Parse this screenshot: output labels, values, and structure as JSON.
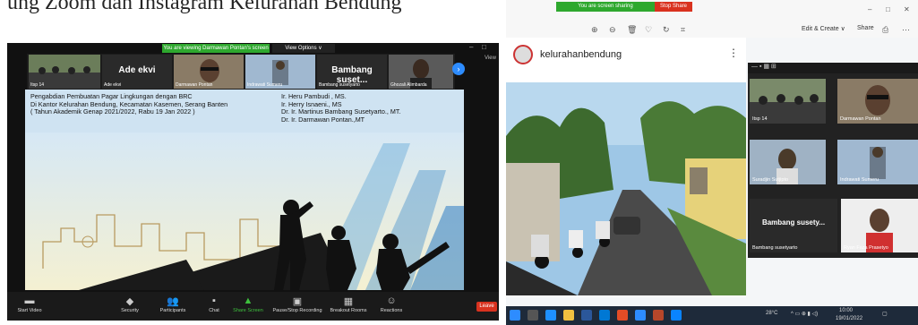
{
  "caption": "ung Zoom dan Instagram Kelurahan Bendung",
  "zoom": {
    "banner": "You are viewing Darmawan Pontan's screen",
    "view_options": "View Options ∨",
    "view_label": "View",
    "participants": [
      {
        "name": "Itsp 14",
        "big": ""
      },
      {
        "name": "Ade ekvi",
        "big": "Ade ekvi"
      },
      {
        "name": "Darmawan Pontan",
        "big": ""
      },
      {
        "name": "Indrawati Sumeru",
        "big": ""
      },
      {
        "name": "Bambang susetyarto",
        "big": "Bambang suset..."
      },
      {
        "name": "Ghozali Alimbarda",
        "big": ""
      }
    ],
    "slide": {
      "line1": "Pengabdian Pembuatan Pagar Lingkungan dengan BRC",
      "line2": "Di Kantor Kelurahan Bendung, Kecamatan Kasemen, Serang Banten",
      "line3": "( Tahun Akademik Genap 2021/2022, Rabu 19 Jan  2022 )",
      "names": [
        "Ir. Heru Pambudi , MS.",
        "Ir. Herry Isnaeni., MS",
        "Dr. Ir. Martinus Bambang Susetyarto., MT.",
        "Dr. Ir. Darmawan Pontan.,MT"
      ]
    },
    "toolbar": [
      {
        "icon": "video-icon",
        "glyph": "▬",
        "label": "Start Video"
      },
      {
        "icon": "shield-icon",
        "glyph": "◆",
        "label": "Security"
      },
      {
        "icon": "participants-icon",
        "glyph": "👥",
        "label": "Participants"
      },
      {
        "icon": "chat-icon",
        "glyph": "▪",
        "label": "Chat"
      },
      {
        "icon": "share-icon",
        "glyph": "▲",
        "label": "Share Screen"
      },
      {
        "icon": "record-icon",
        "glyph": "▣",
        "label": "Pause/Stop Recording"
      },
      {
        "icon": "breakout-icon",
        "glyph": "▦",
        "label": "Breakout Rooms"
      },
      {
        "icon": "reactions-icon",
        "glyph": "☺",
        "label": "Reactions"
      }
    ],
    "leave_label": "Leave",
    "colors": {
      "share_green": "#2ea82e",
      "accent_blue": "#2d8cff",
      "leave_red": "#d9321f"
    }
  },
  "browser": {
    "sharing_text": "You are screen sharing",
    "stop_share": "Stop Share",
    "edit_create": "Edit & Create ∨",
    "share": "Share",
    "instagram_user": "kelurahanbendung",
    "panel_tiles": [
      {
        "name": "Itsp 14",
        "big": ""
      },
      {
        "name": "Darmawan Pontan",
        "big": ""
      },
      {
        "name": "Suradjin Sutjipto",
        "big": ""
      },
      {
        "name": "Indrawati Sumeru",
        "big": ""
      },
      {
        "name": "Bambang susetyarto",
        "big": "Bambang susety..."
      },
      {
        "name": "Ryan Faza Prasetyo",
        "big": ""
      }
    ],
    "tray": {
      "temp": "28°C",
      "time": "10:00",
      "date": "19/01/2022"
    }
  }
}
